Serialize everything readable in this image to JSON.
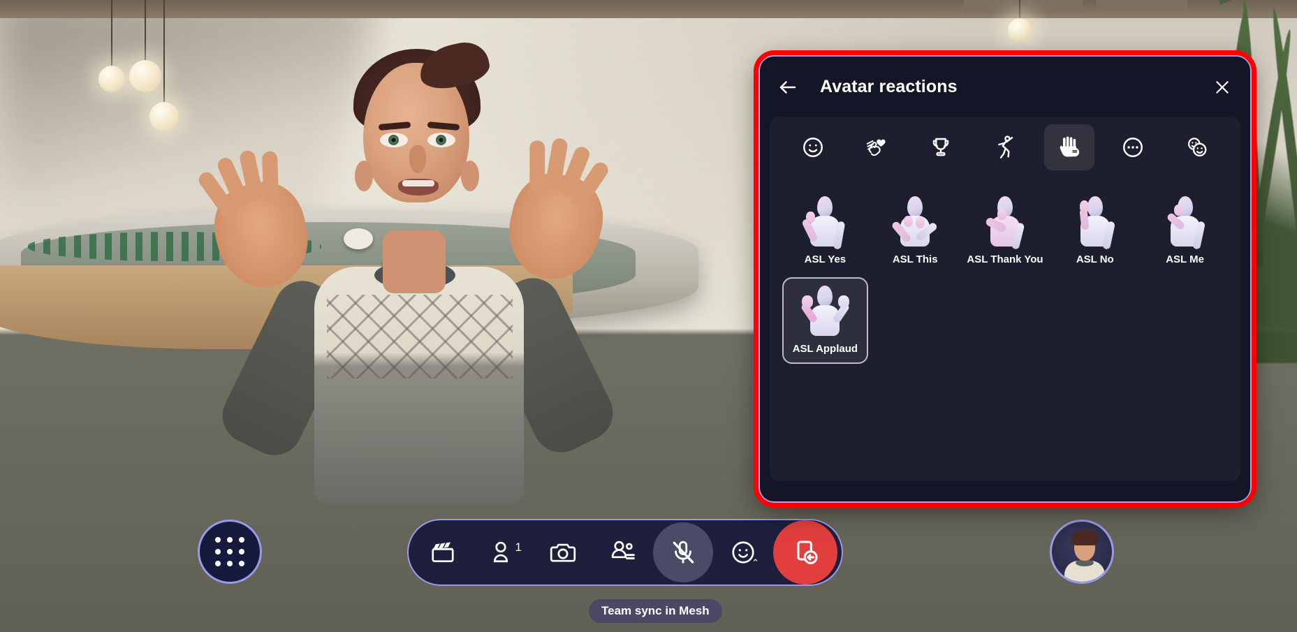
{
  "scene": {
    "description": "3D virtual meeting room with avatar",
    "status_pill": "Team sync in Mesh"
  },
  "dialog": {
    "title": "Avatar reactions",
    "back_label": "Back",
    "close_label": "Close",
    "highlight_color": "#ff0000",
    "border_color": "#a9a6ee",
    "background": "#141527",
    "tabs": [
      {
        "id": "emoji",
        "icon": "smiley-face-icon",
        "label": "Emoji",
        "active": false
      },
      {
        "id": "applause",
        "icon": "applause-heart-icon",
        "label": "Applause",
        "active": false
      },
      {
        "id": "celebrate",
        "icon": "trophy-icon",
        "label": "Celebrate",
        "active": false
      },
      {
        "id": "dance",
        "icon": "dancing-person-icon",
        "label": "Dance",
        "active": false
      },
      {
        "id": "asl",
        "icon": "asl-hand-icon",
        "label": "Sign language",
        "active": true
      },
      {
        "id": "more",
        "icon": "more-circle-icon",
        "label": "More",
        "active": false
      },
      {
        "id": "combined",
        "icon": "multi-emoji-icon",
        "label": "Combined",
        "active": false
      }
    ],
    "reactions": [
      {
        "label": "ASL Yes",
        "selected": false,
        "pose": "yes"
      },
      {
        "label": "ASL This",
        "selected": false,
        "pose": "this"
      },
      {
        "label": "ASL Thank You",
        "selected": false,
        "pose": "thankyou"
      },
      {
        "label": "ASL No",
        "selected": false,
        "pose": "no"
      },
      {
        "label": "ASL Me",
        "selected": false,
        "pose": "me"
      },
      {
        "label": "ASL Applaud",
        "selected": true,
        "pose": "applaud"
      }
    ]
  },
  "toolbar": {
    "apps_label": "Apps",
    "accent_color": "#9a9ae8",
    "background": "#1d1f3d",
    "leave_color": "#e23e3e",
    "participant_count": "1",
    "emoji_caret": "⌃",
    "buttons": [
      {
        "id": "clapperboard",
        "icon": "clapperboard-icon",
        "label": "Scenes",
        "state": "default"
      },
      {
        "id": "people",
        "icon": "person-icon",
        "label": "Participants",
        "state": "default",
        "badge": "1"
      },
      {
        "id": "camera",
        "icon": "camera-icon",
        "label": "Camera",
        "state": "default"
      },
      {
        "id": "view",
        "icon": "view-switch-icon",
        "label": "View",
        "state": "default"
      },
      {
        "id": "mic",
        "icon": "microphone-off-icon",
        "label": "Unmute",
        "state": "muted"
      },
      {
        "id": "reactions",
        "icon": "smiley-face-icon",
        "label": "Reactions",
        "state": "default",
        "caret": "⌃"
      },
      {
        "id": "leave",
        "icon": "leave-door-icon",
        "label": "Leave",
        "state": "danger"
      }
    ]
  },
  "self_view": {
    "label": "Your avatar"
  }
}
